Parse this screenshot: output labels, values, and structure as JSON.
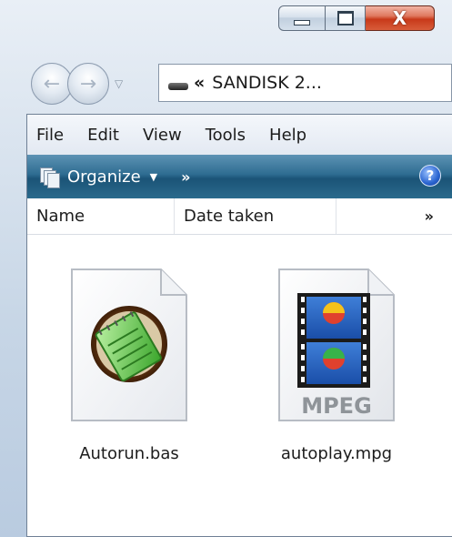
{
  "window": {
    "caption_buttons": {
      "minimize": "minimize",
      "maximize": "maximize",
      "close": "X"
    }
  },
  "navigation": {
    "back_icon": "back-arrow-icon",
    "forward_icon": "forward-arrow-icon",
    "address": {
      "prefix": "«",
      "location": "SANDISK 2..."
    }
  },
  "menubar": {
    "items": [
      "File",
      "Edit",
      "View",
      "Tools",
      "Help"
    ]
  },
  "toolbar": {
    "organize_label": "Organize",
    "more_label": "»",
    "help_label": "?"
  },
  "columns": {
    "name": "Name",
    "date_taken": "Date taken",
    "more": "»"
  },
  "files": [
    {
      "name": "Autorun.bas",
      "icon": "notepad-document-icon"
    },
    {
      "name": "autoplay.mpg",
      "icon": "mpeg-video-icon",
      "badge": "MPEG"
    }
  ],
  "colors": {
    "toolbar": "#2e6c91",
    "close_button": "#c8391a",
    "help_button": "#2a64d0"
  }
}
